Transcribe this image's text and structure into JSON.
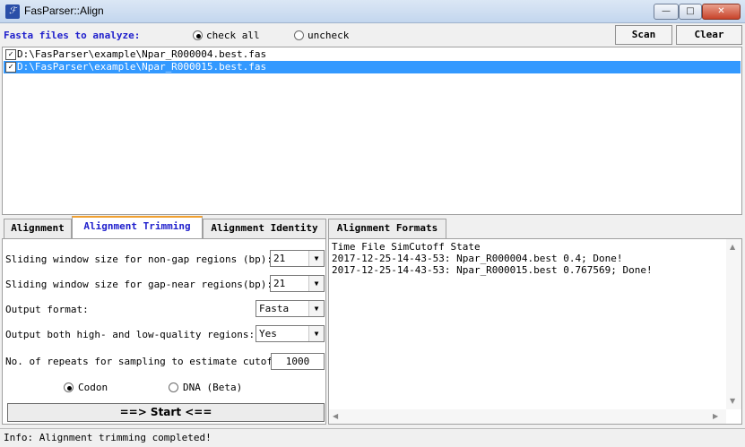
{
  "window": {
    "title": "FasParser::Align",
    "app_icon": "ℱ",
    "minimize": "—",
    "maximize": "□",
    "close": "✕"
  },
  "top": {
    "fasta_label": "Fasta files to analyze:",
    "check_all": "check all",
    "uncheck": "uncheck",
    "check_all_selected": true,
    "scan_label": "Scan",
    "clear_label": "Clear"
  },
  "files": [
    {
      "path": "D:\\FasParser\\example\\Npar_R000004.best.fas",
      "checked": true,
      "selected": false
    },
    {
      "path": "D:\\FasParser\\example\\Npar_R000015.best.fas",
      "checked": true,
      "selected": true
    }
  ],
  "tabs": [
    {
      "label": "Alignment",
      "active": false
    },
    {
      "label": "Alignment Trimming",
      "active": true
    },
    {
      "label": "Alignment Identity",
      "active": false
    },
    {
      "label": "Alignment Formats",
      "active": false
    }
  ],
  "trimming": {
    "nongap_label": "Sliding window size for non-gap regions (bp):",
    "nongap_value": "21",
    "gapnear_label": "Sliding window size for gap-near regions(bp):",
    "gapnear_value": "21",
    "format_label": "Output format:",
    "format_value": "Fasta",
    "both_label": "Output both high- and low-quality regions:",
    "both_value": "Yes",
    "repeats_label": "No. of repeats for sampling to estimate cutoff:",
    "repeats_value": "1000",
    "codon_label": "Codon",
    "dna_label": "DNA (Beta)",
    "codon_selected": true,
    "start_label": "==> Start <=="
  },
  "log": [
    "Time File SimCutoff State",
    "2017-12-25-14-43-53: Npar_R000004.best 0.4; Done!",
    "2017-12-25-14-43-53: Npar_R000015.best 0.767569; Done!"
  ],
  "scroll": {
    "up": "▲",
    "down": "▼",
    "left": "◀",
    "right": "▶"
  },
  "status": "Info: Alignment trimming completed!",
  "colors": {
    "accent_blue": "#1f1fcc",
    "selection": "#3399ff",
    "tab_highlight": "#f0a030"
  }
}
